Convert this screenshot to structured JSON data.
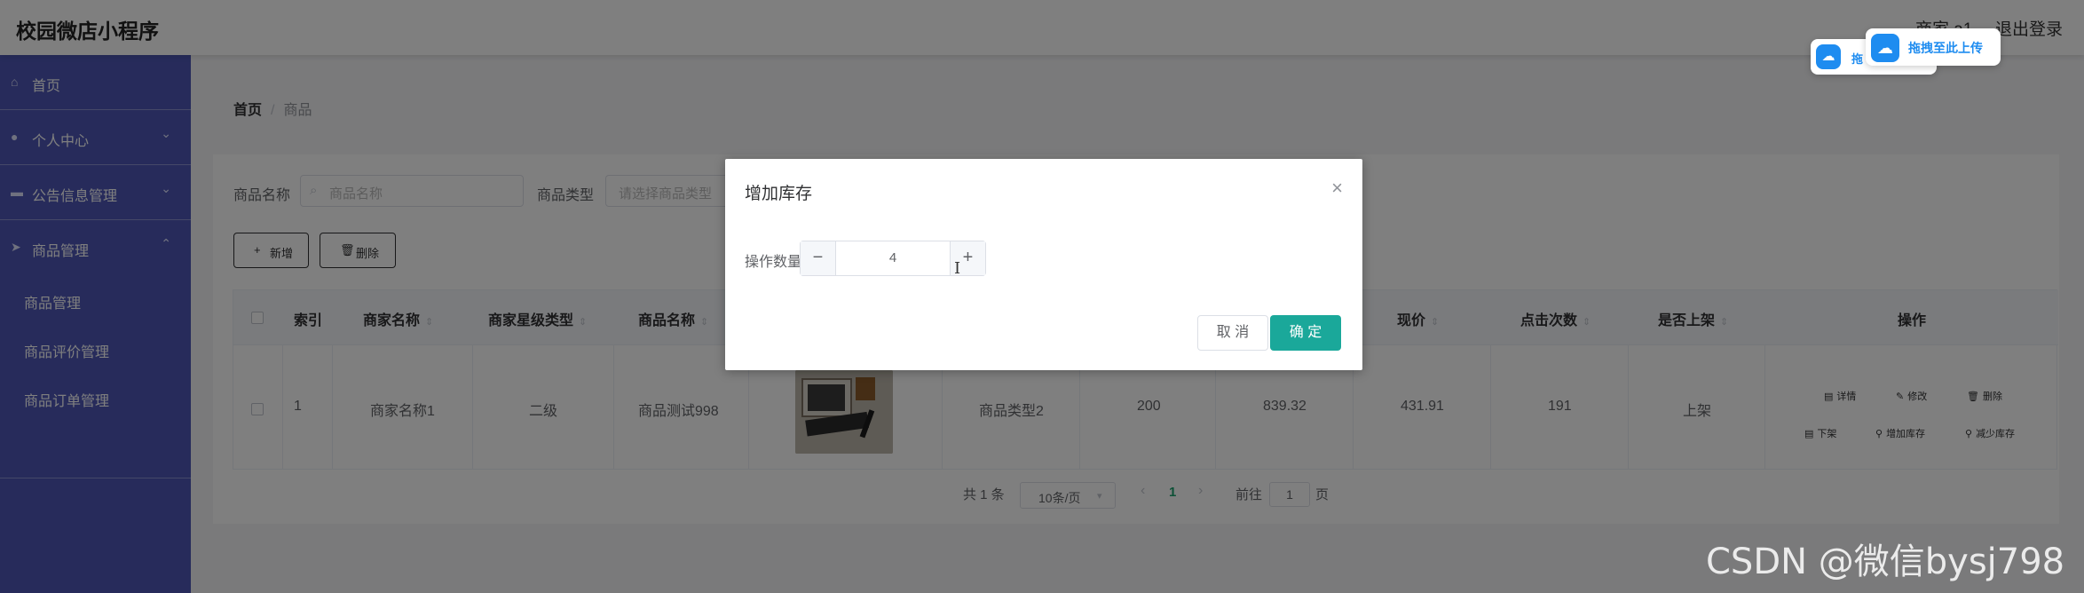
{
  "header": {
    "title": "校园微店小程序",
    "user": "商家 a1",
    "logout": "退出登录"
  },
  "sidebar": {
    "items": [
      {
        "label": "首页",
        "icon": "home-icon"
      },
      {
        "label": "个人中心",
        "icon": "user-icon"
      },
      {
        "label": "公告信息管理",
        "icon": "briefcase-icon"
      },
      {
        "label": "商品管理",
        "icon": "send-icon"
      }
    ],
    "subitems": [
      "商品管理",
      "商品评价管理",
      "商品订单管理"
    ]
  },
  "breadcrumb": {
    "home": "首页",
    "separator": "/",
    "current": "商品"
  },
  "search": {
    "name_label": "商品名称",
    "name_placeholder": "商品名称",
    "type_label": "商品类型",
    "type_placeholder": "请选择商品类型"
  },
  "toolbar": {
    "add_label": "新增",
    "delete_label": "删除"
  },
  "table": {
    "headers": [
      "索引",
      "商家名称",
      "商家星级类型",
      "商品名称",
      "现价",
      "点击次数",
      "是否上架",
      "操作"
    ],
    "row": {
      "index": "1",
      "merchant": "商家名称1",
      "star_level": "二级",
      "product_name": "商品测试998",
      "product_type": "商品类型2",
      "stock": "200",
      "original_price": "839.32",
      "current_price": "431.91",
      "clicks": "191",
      "on_shelf": "上架"
    },
    "actions": [
      "详情",
      "修改",
      "删除",
      "下架",
      "增加库存",
      "减少库存"
    ]
  },
  "pagination": {
    "total": "共 1 条",
    "page_size": "10条/页",
    "current_page": "1",
    "goto_label": "前往",
    "goto_value": "1",
    "page_unit": "页"
  },
  "upload_badges": {
    "label_full": "拖拽至此上传",
    "label_partial": "拖"
  },
  "dialog": {
    "title": "增加库存",
    "field_label": "操作数量",
    "value": "4",
    "cancel": "取 消",
    "confirm": "确 定"
  },
  "watermark": "CSDN @微信bysj798",
  "colors": {
    "sidebar": "#4e57b6",
    "primary": "#1aa89a",
    "upload_blue": "#1e8cf0"
  }
}
